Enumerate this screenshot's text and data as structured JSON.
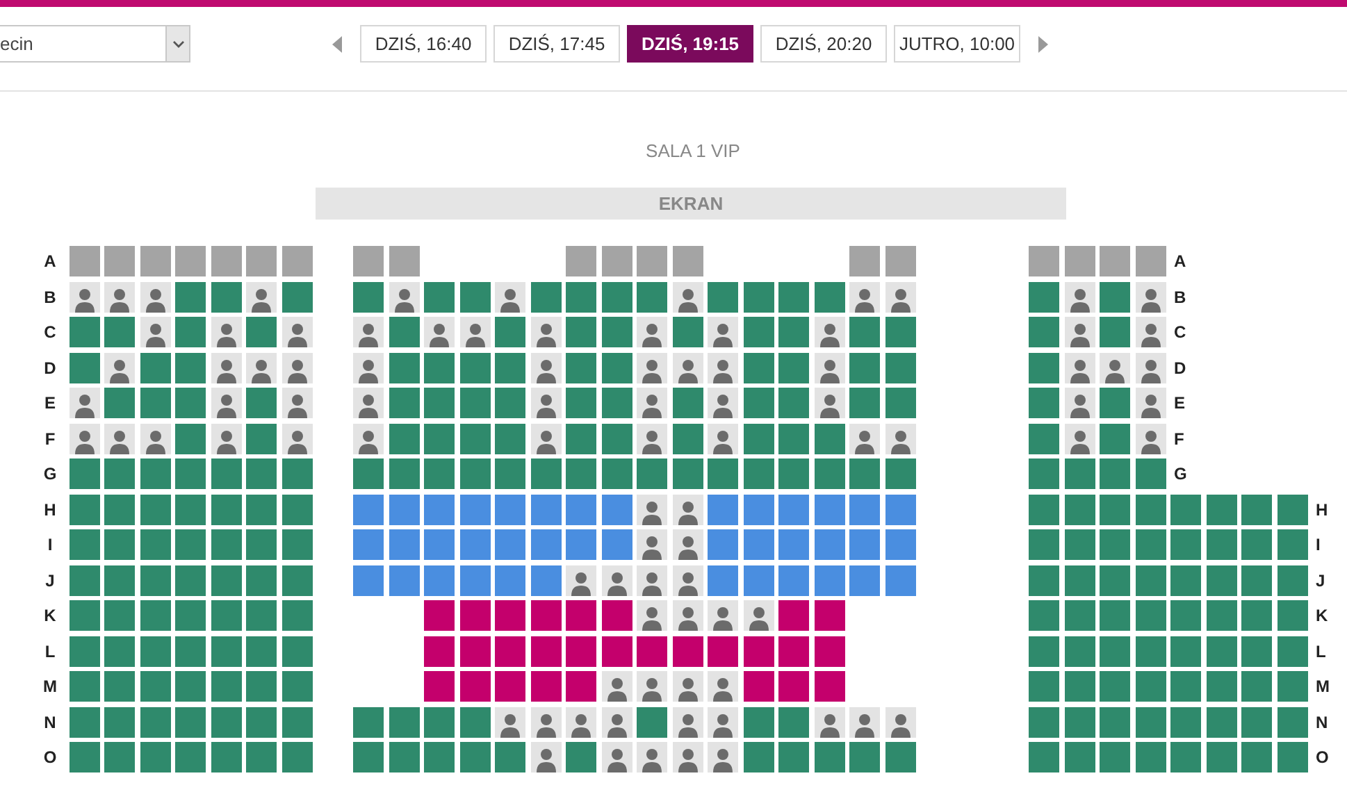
{
  "city_select": {
    "value": "ecin"
  },
  "showtimes": [
    {
      "label": "DZIŚ, 16:40",
      "selected": false
    },
    {
      "label": "DZIŚ, 17:45",
      "selected": false
    },
    {
      "label": "DZIŚ, 19:15",
      "selected": true
    },
    {
      "label": "DZIŚ, 20:20",
      "selected": false
    },
    {
      "label": "JUTRO, 10:00",
      "selected": false
    }
  ],
  "hall": {
    "title": "SALA 1 VIP",
    "screen_label": "EKRAN"
  },
  "rows": [
    {
      "label_left": "A",
      "left": [
        {
          "kind": "unavailable"
        },
        {
          "kind": "unavailable"
        },
        {
          "kind": "unavailable"
        },
        {
          "kind": "unavailable"
        },
        {
          "kind": "unavailable"
        },
        {
          "kind": "unavailable"
        },
        {
          "kind": "unavailable"
        }
      ],
      "middle": [
        {
          "kind": "unavailable"
        },
        {
          "kind": "unavailable"
        },
        {
          "kind": "gap"
        },
        {
          "kind": "gap"
        },
        {
          "kind": "gap"
        },
        {
          "kind": "gap"
        },
        {
          "kind": "unavailable"
        },
        {
          "kind": "unavailable"
        },
        {
          "kind": "unavailable"
        },
        {
          "kind": "unavailable"
        },
        {
          "kind": "gap"
        },
        {
          "kind": "gap"
        },
        {
          "kind": "gap"
        },
        {
          "kind": "gap"
        },
        {
          "kind": "unavailable"
        },
        {
          "kind": "unavailable"
        }
      ],
      "right": [
        {
          "kind": "unavailable"
        },
        {
          "kind": "unavailable"
        },
        {
          "kind": "unavailable"
        },
        {
          "kind": "unavailable"
        }
      ],
      "label_right": "A"
    },
    {
      "label_left": "B",
      "left": [
        {
          "kind": "taken"
        },
        {
          "kind": "taken"
        },
        {
          "kind": "taken"
        },
        {
          "kind": "free"
        },
        {
          "kind": "free"
        },
        {
          "kind": "taken"
        },
        {
          "kind": "free"
        }
      ],
      "middle": [
        {
          "kind": "free"
        },
        {
          "kind": "taken"
        },
        {
          "kind": "free"
        },
        {
          "kind": "free"
        },
        {
          "kind": "taken"
        },
        {
          "kind": "free"
        },
        {
          "kind": "free"
        },
        {
          "kind": "free"
        },
        {
          "kind": "free"
        },
        {
          "kind": "taken"
        },
        {
          "kind": "free"
        },
        {
          "kind": "free"
        },
        {
          "kind": "free"
        },
        {
          "kind": "free"
        },
        {
          "kind": "taken"
        },
        {
          "kind": "taken"
        }
      ],
      "right": [
        {
          "kind": "free"
        },
        {
          "kind": "taken"
        },
        {
          "kind": "free"
        },
        {
          "kind": "taken"
        }
      ],
      "label_right": "B"
    },
    {
      "label_left": "C",
      "left": [
        {
          "kind": "free"
        },
        {
          "kind": "free"
        },
        {
          "kind": "taken"
        },
        {
          "kind": "free"
        },
        {
          "kind": "taken"
        },
        {
          "kind": "free"
        },
        {
          "kind": "taken"
        }
      ],
      "middle": [
        {
          "kind": "taken"
        },
        {
          "kind": "free"
        },
        {
          "kind": "taken"
        },
        {
          "kind": "taken"
        },
        {
          "kind": "free"
        },
        {
          "kind": "taken"
        },
        {
          "kind": "free"
        },
        {
          "kind": "free"
        },
        {
          "kind": "taken"
        },
        {
          "kind": "free"
        },
        {
          "kind": "taken"
        },
        {
          "kind": "free"
        },
        {
          "kind": "free"
        },
        {
          "kind": "taken"
        },
        {
          "kind": "free"
        },
        {
          "kind": "free"
        }
      ],
      "right": [
        {
          "kind": "free"
        },
        {
          "kind": "taken"
        },
        {
          "kind": "free"
        },
        {
          "kind": "taken"
        }
      ],
      "label_right": "C"
    },
    {
      "label_left": "D",
      "left": [
        {
          "kind": "free"
        },
        {
          "kind": "taken"
        },
        {
          "kind": "free"
        },
        {
          "kind": "free"
        },
        {
          "kind": "taken"
        },
        {
          "kind": "taken"
        },
        {
          "kind": "taken"
        }
      ],
      "middle": [
        {
          "kind": "taken"
        },
        {
          "kind": "free"
        },
        {
          "kind": "free"
        },
        {
          "kind": "free"
        },
        {
          "kind": "free"
        },
        {
          "kind": "taken"
        },
        {
          "kind": "free"
        },
        {
          "kind": "free"
        },
        {
          "kind": "taken"
        },
        {
          "kind": "taken"
        },
        {
          "kind": "taken"
        },
        {
          "kind": "free"
        },
        {
          "kind": "free"
        },
        {
          "kind": "taken"
        },
        {
          "kind": "free"
        },
        {
          "kind": "free"
        }
      ],
      "right": [
        {
          "kind": "free"
        },
        {
          "kind": "taken"
        },
        {
          "kind": "taken"
        },
        {
          "kind": "taken"
        }
      ],
      "label_right": "D"
    },
    {
      "label_left": "E",
      "left": [
        {
          "kind": "taken"
        },
        {
          "kind": "free"
        },
        {
          "kind": "free"
        },
        {
          "kind": "free"
        },
        {
          "kind": "taken"
        },
        {
          "kind": "free"
        },
        {
          "kind": "taken"
        }
      ],
      "middle": [
        {
          "kind": "taken"
        },
        {
          "kind": "free"
        },
        {
          "kind": "free"
        },
        {
          "kind": "free"
        },
        {
          "kind": "free"
        },
        {
          "kind": "taken"
        },
        {
          "kind": "free"
        },
        {
          "kind": "free"
        },
        {
          "kind": "taken"
        },
        {
          "kind": "free"
        },
        {
          "kind": "taken"
        },
        {
          "kind": "free"
        },
        {
          "kind": "free"
        },
        {
          "kind": "taken"
        },
        {
          "kind": "free"
        },
        {
          "kind": "free"
        }
      ],
      "right": [
        {
          "kind": "free"
        },
        {
          "kind": "taken"
        },
        {
          "kind": "free"
        },
        {
          "kind": "taken"
        }
      ],
      "label_right": "E"
    },
    {
      "label_left": "F",
      "left": [
        {
          "kind": "taken"
        },
        {
          "kind": "taken"
        },
        {
          "kind": "taken"
        },
        {
          "kind": "free"
        },
        {
          "kind": "taken"
        },
        {
          "kind": "free"
        },
        {
          "kind": "taken"
        }
      ],
      "middle": [
        {
          "kind": "taken"
        },
        {
          "kind": "free"
        },
        {
          "kind": "free"
        },
        {
          "kind": "free"
        },
        {
          "kind": "free"
        },
        {
          "kind": "taken"
        },
        {
          "kind": "free"
        },
        {
          "kind": "free"
        },
        {
          "kind": "taken"
        },
        {
          "kind": "free"
        },
        {
          "kind": "taken"
        },
        {
          "kind": "free"
        },
        {
          "kind": "free"
        },
        {
          "kind": "free"
        },
        {
          "kind": "taken"
        },
        {
          "kind": "taken"
        }
      ],
      "right": [
        {
          "kind": "free"
        },
        {
          "kind": "taken"
        },
        {
          "kind": "free"
        },
        {
          "kind": "taken"
        }
      ],
      "label_right": "F"
    },
    {
      "label_left": "G",
      "left": [
        {
          "kind": "free"
        },
        {
          "kind": "free"
        },
        {
          "kind": "free"
        },
        {
          "kind": "free"
        },
        {
          "kind": "free"
        },
        {
          "kind": "free"
        },
        {
          "kind": "free"
        }
      ],
      "middle": [
        {
          "kind": "free"
        },
        {
          "kind": "free"
        },
        {
          "kind": "free"
        },
        {
          "kind": "free"
        },
        {
          "kind": "free"
        },
        {
          "kind": "free"
        },
        {
          "kind": "free"
        },
        {
          "kind": "free"
        },
        {
          "kind": "free"
        },
        {
          "kind": "free"
        },
        {
          "kind": "free"
        },
        {
          "kind": "free"
        },
        {
          "kind": "free"
        },
        {
          "kind": "free"
        },
        {
          "kind": "free"
        },
        {
          "kind": "free"
        }
      ],
      "right": [
        {
          "kind": "free"
        },
        {
          "kind": "free"
        },
        {
          "kind": "free"
        },
        {
          "kind": "free"
        }
      ],
      "label_right": "G"
    },
    {
      "label_left": "H",
      "left": [
        {
          "kind": "free"
        },
        {
          "kind": "free"
        },
        {
          "kind": "free"
        },
        {
          "kind": "free"
        },
        {
          "kind": "free"
        },
        {
          "kind": "free"
        },
        {
          "kind": "free"
        }
      ],
      "middle": [
        {
          "kind": "free_blue"
        },
        {
          "kind": "free_blue"
        },
        {
          "kind": "free_blue"
        },
        {
          "kind": "free_blue"
        },
        {
          "kind": "free_blue"
        },
        {
          "kind": "free_blue"
        },
        {
          "kind": "free_blue"
        },
        {
          "kind": "free_blue"
        },
        {
          "kind": "taken"
        },
        {
          "kind": "taken"
        },
        {
          "kind": "free_blue"
        },
        {
          "kind": "free_blue"
        },
        {
          "kind": "free_blue"
        },
        {
          "kind": "free_blue"
        },
        {
          "kind": "free_blue"
        },
        {
          "kind": "free_blue"
        }
      ],
      "right": [
        {
          "kind": "free"
        },
        {
          "kind": "free"
        },
        {
          "kind": "free"
        },
        {
          "kind": "free"
        },
        {
          "kind": "free"
        },
        {
          "kind": "free"
        },
        {
          "kind": "free"
        },
        {
          "kind": "free"
        }
      ],
      "label_right": "H"
    },
    {
      "label_left": "I",
      "left": [
        {
          "kind": "free"
        },
        {
          "kind": "free"
        },
        {
          "kind": "free"
        },
        {
          "kind": "free"
        },
        {
          "kind": "free"
        },
        {
          "kind": "free"
        },
        {
          "kind": "free"
        }
      ],
      "middle": [
        {
          "kind": "free_blue"
        },
        {
          "kind": "free_blue"
        },
        {
          "kind": "free_blue"
        },
        {
          "kind": "free_blue"
        },
        {
          "kind": "free_blue"
        },
        {
          "kind": "free_blue"
        },
        {
          "kind": "free_blue"
        },
        {
          "kind": "free_blue"
        },
        {
          "kind": "taken"
        },
        {
          "kind": "taken"
        },
        {
          "kind": "free_blue"
        },
        {
          "kind": "free_blue"
        },
        {
          "kind": "free_blue"
        },
        {
          "kind": "free_blue"
        },
        {
          "kind": "free_blue"
        },
        {
          "kind": "free_blue"
        }
      ],
      "right": [
        {
          "kind": "free"
        },
        {
          "kind": "free"
        },
        {
          "kind": "free"
        },
        {
          "kind": "free"
        },
        {
          "kind": "free"
        },
        {
          "kind": "free"
        },
        {
          "kind": "free"
        },
        {
          "kind": "free"
        }
      ],
      "label_right": "I"
    },
    {
      "label_left": "J",
      "left": [
        {
          "kind": "free"
        },
        {
          "kind": "free"
        },
        {
          "kind": "free"
        },
        {
          "kind": "free"
        },
        {
          "kind": "free"
        },
        {
          "kind": "free"
        },
        {
          "kind": "free"
        }
      ],
      "middle": [
        {
          "kind": "free_blue"
        },
        {
          "kind": "free_blue"
        },
        {
          "kind": "free_blue"
        },
        {
          "kind": "free_blue"
        },
        {
          "kind": "free_blue"
        },
        {
          "kind": "free_blue"
        },
        {
          "kind": "taken"
        },
        {
          "kind": "taken"
        },
        {
          "kind": "taken"
        },
        {
          "kind": "taken"
        },
        {
          "kind": "free_blue"
        },
        {
          "kind": "free_blue"
        },
        {
          "kind": "free_blue"
        },
        {
          "kind": "free_blue"
        },
        {
          "kind": "free_blue"
        },
        {
          "kind": "free_blue"
        }
      ],
      "right": [
        {
          "kind": "free"
        },
        {
          "kind": "free"
        },
        {
          "kind": "free"
        },
        {
          "kind": "free"
        },
        {
          "kind": "free"
        },
        {
          "kind": "free"
        },
        {
          "kind": "free"
        },
        {
          "kind": "free"
        }
      ],
      "label_right": "J"
    },
    {
      "label_left": "K",
      "left": [
        {
          "kind": "free"
        },
        {
          "kind": "free"
        },
        {
          "kind": "free"
        },
        {
          "kind": "free"
        },
        {
          "kind": "free"
        },
        {
          "kind": "free"
        },
        {
          "kind": "free"
        }
      ],
      "middle": [
        {
          "kind": "gap"
        },
        {
          "kind": "gap"
        },
        {
          "kind": "free_pink"
        },
        {
          "kind": "free_pink"
        },
        {
          "kind": "free_pink"
        },
        {
          "kind": "free_pink"
        },
        {
          "kind": "free_pink"
        },
        {
          "kind": "free_pink"
        },
        {
          "kind": "taken"
        },
        {
          "kind": "taken"
        },
        {
          "kind": "taken"
        },
        {
          "kind": "taken"
        },
        {
          "kind": "free_pink"
        },
        {
          "kind": "free_pink"
        },
        {
          "kind": "gap"
        },
        {
          "kind": "gap"
        }
      ],
      "right": [
        {
          "kind": "free"
        },
        {
          "kind": "free"
        },
        {
          "kind": "free"
        },
        {
          "kind": "free"
        },
        {
          "kind": "free"
        },
        {
          "kind": "free"
        },
        {
          "kind": "free"
        },
        {
          "kind": "free"
        }
      ],
      "label_right": "K"
    },
    {
      "label_left": "L",
      "left": [
        {
          "kind": "free"
        },
        {
          "kind": "free"
        },
        {
          "kind": "free"
        },
        {
          "kind": "free"
        },
        {
          "kind": "free"
        },
        {
          "kind": "free"
        },
        {
          "kind": "free"
        }
      ],
      "middle": [
        {
          "kind": "gap"
        },
        {
          "kind": "gap"
        },
        {
          "kind": "free_pink"
        },
        {
          "kind": "free_pink"
        },
        {
          "kind": "free_pink"
        },
        {
          "kind": "free_pink"
        },
        {
          "kind": "free_pink"
        },
        {
          "kind": "free_pink"
        },
        {
          "kind": "free_pink"
        },
        {
          "kind": "free_pink"
        },
        {
          "kind": "free_pink"
        },
        {
          "kind": "free_pink"
        },
        {
          "kind": "free_pink"
        },
        {
          "kind": "free_pink"
        },
        {
          "kind": "gap"
        },
        {
          "kind": "gap"
        }
      ],
      "right": [
        {
          "kind": "free"
        },
        {
          "kind": "free"
        },
        {
          "kind": "free"
        },
        {
          "kind": "free"
        },
        {
          "kind": "free"
        },
        {
          "kind": "free"
        },
        {
          "kind": "free"
        },
        {
          "kind": "free"
        }
      ],
      "label_right": "L"
    },
    {
      "label_left": "M",
      "left": [
        {
          "kind": "free"
        },
        {
          "kind": "free"
        },
        {
          "kind": "free"
        },
        {
          "kind": "free"
        },
        {
          "kind": "free"
        },
        {
          "kind": "free"
        },
        {
          "kind": "free"
        }
      ],
      "middle": [
        {
          "kind": "gap"
        },
        {
          "kind": "gap"
        },
        {
          "kind": "free_pink"
        },
        {
          "kind": "free_pink"
        },
        {
          "kind": "free_pink"
        },
        {
          "kind": "free_pink"
        },
        {
          "kind": "free_pink"
        },
        {
          "kind": "taken"
        },
        {
          "kind": "taken"
        },
        {
          "kind": "taken"
        },
        {
          "kind": "taken"
        },
        {
          "kind": "free_pink"
        },
        {
          "kind": "free_pink"
        },
        {
          "kind": "free_pink"
        },
        {
          "kind": "gap"
        },
        {
          "kind": "gap"
        }
      ],
      "right": [
        {
          "kind": "free"
        },
        {
          "kind": "free"
        },
        {
          "kind": "free"
        },
        {
          "kind": "free"
        },
        {
          "kind": "free"
        },
        {
          "kind": "free"
        },
        {
          "kind": "free"
        },
        {
          "kind": "free"
        }
      ],
      "label_right": "M"
    },
    {
      "label_left": "N",
      "left": [
        {
          "kind": "free"
        },
        {
          "kind": "free"
        },
        {
          "kind": "free"
        },
        {
          "kind": "free"
        },
        {
          "kind": "free"
        },
        {
          "kind": "free"
        },
        {
          "kind": "free"
        }
      ],
      "middle": [
        {
          "kind": "free"
        },
        {
          "kind": "free"
        },
        {
          "kind": "free"
        },
        {
          "kind": "free"
        },
        {
          "kind": "taken"
        },
        {
          "kind": "taken"
        },
        {
          "kind": "taken"
        },
        {
          "kind": "taken"
        },
        {
          "kind": "free"
        },
        {
          "kind": "taken"
        },
        {
          "kind": "taken"
        },
        {
          "kind": "free"
        },
        {
          "kind": "free"
        },
        {
          "kind": "taken"
        },
        {
          "kind": "taken"
        },
        {
          "kind": "taken"
        }
      ],
      "right": [
        {
          "kind": "free"
        },
        {
          "kind": "free"
        },
        {
          "kind": "free"
        },
        {
          "kind": "free"
        },
        {
          "kind": "free"
        },
        {
          "kind": "free"
        },
        {
          "kind": "free"
        },
        {
          "kind": "free"
        }
      ],
      "label_right": "N"
    },
    {
      "label_left": "O",
      "left": [
        {
          "kind": "free"
        },
        {
          "kind": "free"
        },
        {
          "kind": "free"
        },
        {
          "kind": "free"
        },
        {
          "kind": "free"
        },
        {
          "kind": "free"
        },
        {
          "kind": "free"
        }
      ],
      "middle": [
        {
          "kind": "free"
        },
        {
          "kind": "free"
        },
        {
          "kind": "free"
        },
        {
          "kind": "free"
        },
        {
          "kind": "free"
        },
        {
          "kind": "taken"
        },
        {
          "kind": "free"
        },
        {
          "kind": "taken"
        },
        {
          "kind": "taken"
        },
        {
          "kind": "taken"
        },
        {
          "kind": "taken"
        },
        {
          "kind": "free"
        },
        {
          "kind": "free"
        },
        {
          "kind": "free"
        },
        {
          "kind": "free"
        },
        {
          "kind": "free"
        }
      ],
      "right": [
        {
          "kind": "free"
        },
        {
          "kind": "free"
        },
        {
          "kind": "free"
        },
        {
          "kind": "free"
        },
        {
          "kind": "free"
        },
        {
          "kind": "free"
        },
        {
          "kind": "free"
        },
        {
          "kind": "free"
        }
      ],
      "label_right": "O"
    }
  ]
}
